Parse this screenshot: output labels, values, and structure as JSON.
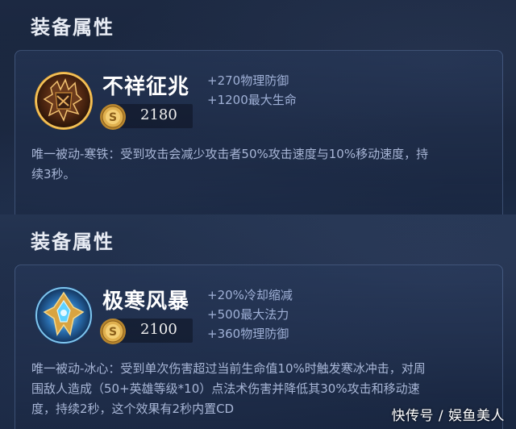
{
  "items": [
    {
      "section_title": "装备属性",
      "name": "不祥征兆",
      "price": "2180",
      "icon": "spiked-armor-icon",
      "stats": [
        "+270物理防御",
        "+1200最大生命"
      ],
      "description_lines": [
        "唯一被动-寒铁：受到攻击会减少攻击者50%攻击速度与10%移动速度，持",
        "续3秒。"
      ]
    },
    {
      "section_title": "装备属性",
      "name": "极寒风暴",
      "price": "2100",
      "icon": "ice-gem-icon",
      "stats": [
        "+20%冷却缩减",
        "+500最大法力",
        "+360物理防御"
      ],
      "description_lines": [
        "唯一被动-冰心：受到单次伤害超过当前生命值10%时触发寒冰冲击，对周",
        "围敌人造成（50+英雄等级*10）点法术伤害并降低其30%攻击和移动速",
        "度，持续2秒，这个效果有2秒内置CD"
      ]
    }
  ],
  "currency_icon": "gold-coin-icon",
  "watermark": "快传号 / 娱鱼美人",
  "colors": {
    "background": "#1a2640",
    "title": "#e8ecf4",
    "stat_text": "#9fb0d6",
    "description_text": "#a8b6d6",
    "coin_gold": "#d9a441"
  }
}
